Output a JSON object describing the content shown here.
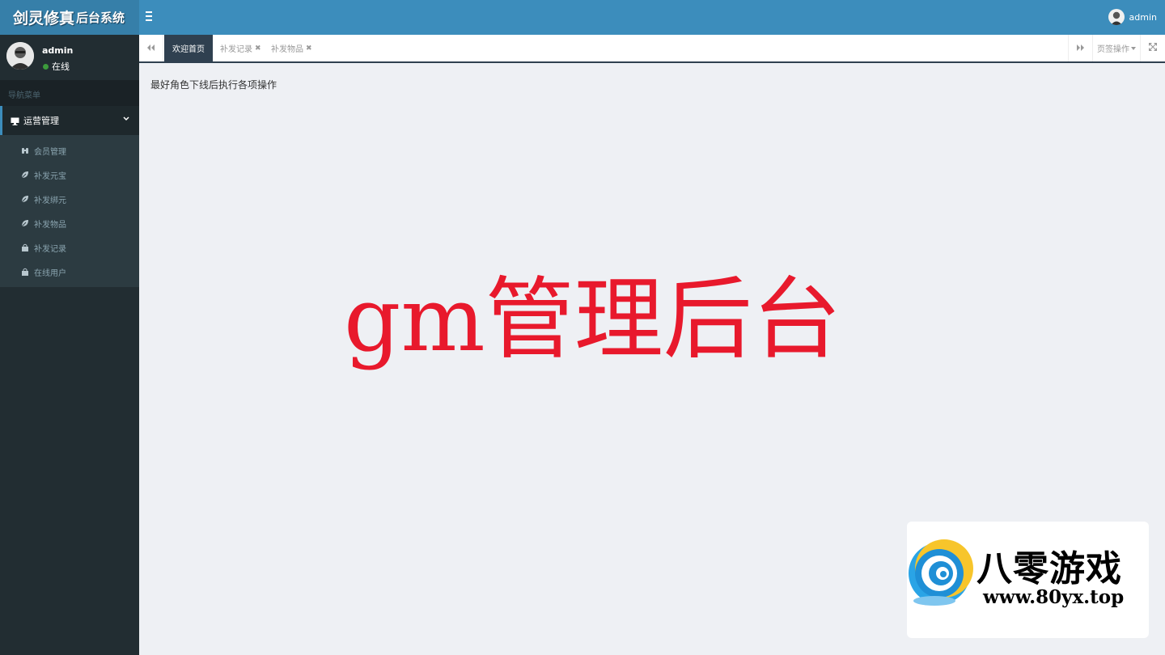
{
  "app": {
    "logo_main": "剑灵修真",
    "logo_sub": "后台系统"
  },
  "header": {
    "user_name": "admin"
  },
  "sidebar": {
    "user": {
      "name": "admin",
      "status": "在线"
    },
    "nav_header": "导航菜单",
    "group_label": "运营管理",
    "items": [
      {
        "label": "会员管理",
        "icon": "binoculars-icon"
      },
      {
        "label": "补发元宝",
        "icon": "leaf-icon"
      },
      {
        "label": "补发绑元",
        "icon": "leaf-icon"
      },
      {
        "label": "补发物品",
        "icon": "leaf-icon"
      },
      {
        "label": "补发记录",
        "icon": "bag-icon"
      },
      {
        "label": "在线用户",
        "icon": "bag-icon"
      }
    ]
  },
  "tabs": [
    {
      "label": "欢迎首页",
      "active": true,
      "closable": false
    },
    {
      "label": "补发记录",
      "active": false,
      "closable": true
    },
    {
      "label": "补发物品",
      "active": false,
      "closable": true
    }
  ],
  "tab_actions": {
    "page_ops": "页签操作"
  },
  "content": {
    "notice": "最好角色下线后执行各项操作",
    "big_title": "gm管理后台"
  },
  "brand": {
    "name": "八零游戏",
    "url": "www.80yx.top"
  },
  "colors": {
    "header": "#3c8dbc",
    "logo_bg": "#367fa9",
    "sidebar": "#222d32",
    "active_tab": "#2f4050",
    "title_red": "#e8192c"
  }
}
